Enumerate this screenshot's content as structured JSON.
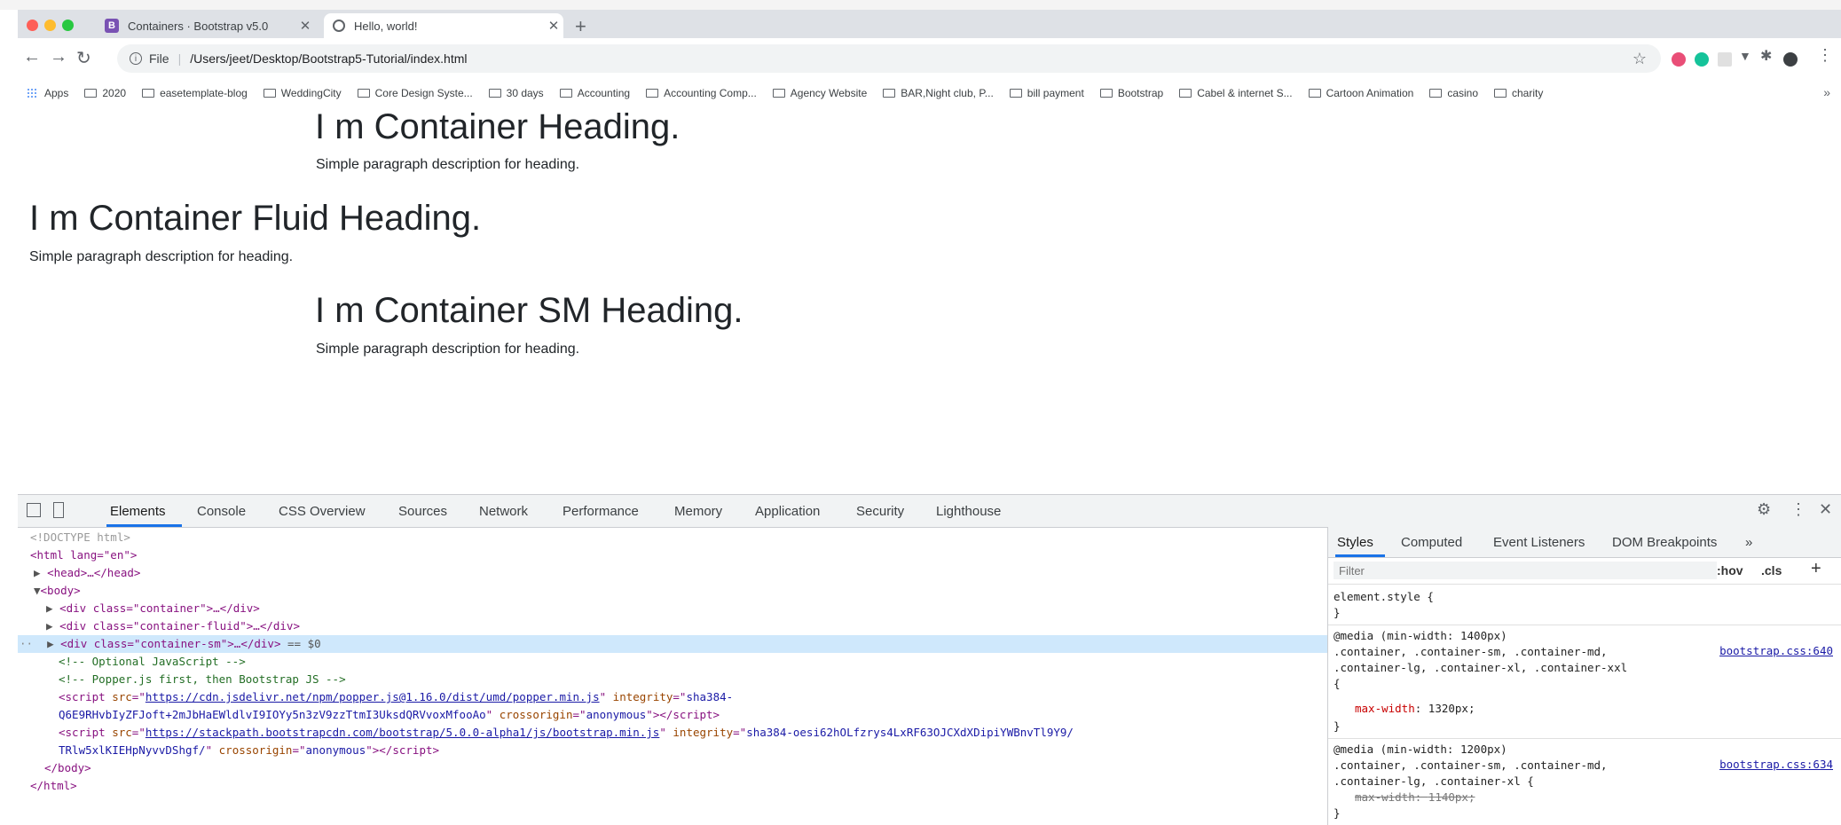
{
  "browser": {
    "tabs": [
      {
        "favicon": "bootstrap-icon",
        "title": "Containers · Bootstrap v5.0",
        "active": false
      },
      {
        "favicon": "globe-icon",
        "title": "Hello, world!",
        "active": true
      }
    ],
    "new_tab": "+",
    "address": {
      "scheme_label": "File",
      "url": "/Users/jeet/Desktop/Bootstrap5-Tutorial/index.html"
    },
    "bookmarks": [
      "Apps",
      "2020",
      "easetemplate-blog",
      "WeddingCity",
      "Core Design Syste...",
      "30 days",
      "Accounting",
      "Accounting Comp...",
      "Agency Website",
      "BAR,Night club, P...",
      "bill payment",
      "Bootstrap",
      "Cabel & internet S...",
      "Cartoon Animation",
      "casino",
      "charity"
    ],
    "bookmarks_more": "»"
  },
  "page": {
    "sections": [
      {
        "heading": "I m Container Heading.",
        "paragraph": "Simple paragraph description for heading."
      },
      {
        "heading": "I m Container Fluid Heading.",
        "paragraph": "Simple paragraph description for heading."
      },
      {
        "heading": "I m Container SM Heading.",
        "paragraph": "Simple paragraph description for heading."
      }
    ]
  },
  "devtools": {
    "tabs": [
      "Elements",
      "Console",
      "CSS Overview",
      "Sources",
      "Network",
      "Performance",
      "Memory",
      "Application",
      "Security",
      "Lighthouse"
    ],
    "active_tab": "Elements",
    "elements": {
      "doctype": "<!DOCTYPE html>",
      "html_open": "<html lang=\"en\">",
      "head": "<head>…</head>",
      "body_open": "<body>",
      "div1": "<div class=\"container\">…</div>",
      "div2": "<div class=\"container-fluid\">…</div>",
      "div3": "<div class=\"container-sm\">…</div>",
      "selected_marker": "== $0",
      "comment1": "<!-- Optional JavaScript -->",
      "comment2": "<!-- Popper.js first, then Bootstrap JS -->",
      "script1_src": "https://cdn.jsdelivr.net/npm/popper.js@1.16.0/dist/umd/popper.min.js",
      "script1_integrity_a": "sha384-",
      "script1_integrity_b": "Q6E9RHvbIyZFJoft+2mJbHaEWldlvI9IOYy5n3zV9zzTtmI3UksdQRVvoxMfooAo",
      "script2_src": "https://stackpath.bootstrapcdn.com/bootstrap/5.0.0-alpha1/js/bootstrap.min.js",
      "script2_integrity_a": "sha384-oesi62hOLfzrys4LxRF63OJCXdXDipiYWBnvTl9Y9/",
      "script2_integrity_b": "TRlw5xlKIEHpNyvvDShgf/",
      "crossorigin": "anonymous",
      "body_close": "</body>",
      "html_close": "</html>"
    },
    "styles": {
      "tabs": [
        "Styles",
        "Computed",
        "Event Listeners",
        "DOM Breakpoints",
        "»"
      ],
      "filter_placeholder": "Filter",
      "hov": ":hov",
      "cls": ".cls",
      "add": "+",
      "element_style": "element.style {",
      "close_brace": "}",
      "rule1": {
        "media": "@media (min-width: 1400px)",
        "selector_a": ".container, .container-sm, .container-md,",
        "selector_b": ".container-lg, .container-xl, .container-xxl",
        "open": "{",
        "property": "max-width",
        "value": "1320px;",
        "source": "bootstrap.css:640"
      },
      "rule2": {
        "media": "@media (min-width: 1200px)",
        "selector_a": ".container, .container-sm, .container-md,",
        "selector_b": ".container-lg, .container-xl {",
        "property": "max-width",
        "value": "1140px;",
        "source": "bootstrap.css:634"
      }
    }
  }
}
